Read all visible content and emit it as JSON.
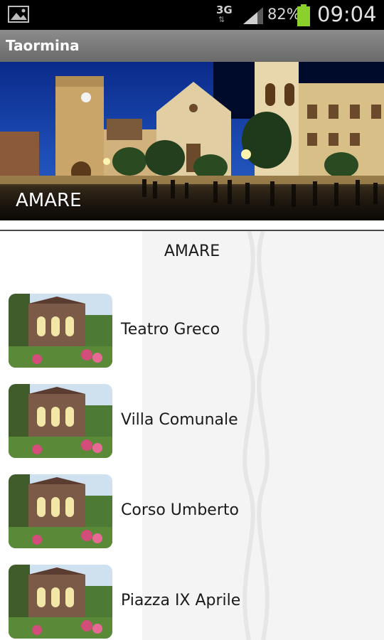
{
  "status_bar": {
    "network": "3G",
    "network_arrows": "⇅",
    "battery_percent": "82%",
    "time": "09:04",
    "icons": [
      "gallery-icon",
      "signal-icon",
      "battery-icon"
    ]
  },
  "app": {
    "title": "Taormina"
  },
  "hero": {
    "label": "AMARE"
  },
  "section": {
    "title": "AMARE"
  },
  "items": [
    {
      "label": "Teatro Greco"
    },
    {
      "label": "Villa Comunale"
    },
    {
      "label": "Corso Umberto"
    },
    {
      "label": "Piazza IX Aprile"
    }
  ],
  "colors": {
    "status_bar_bg": "#000000",
    "title_bar_bg": "#7a7a7a",
    "battery_green": "#8ad12b",
    "text": "#1a1a1a"
  }
}
